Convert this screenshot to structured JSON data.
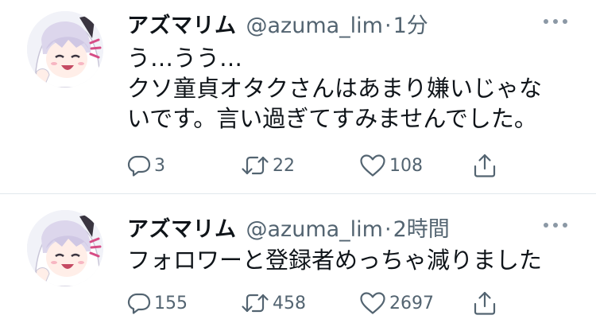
{
  "tweets": [
    {
      "author": {
        "display_name": "アズマリム",
        "handle": "@azuma_lim"
      },
      "separator": "·",
      "time": "1分",
      "text_lines": [
        "う…うう…",
        "クソ童貞オタクさんはあまり嫌いじゃな",
        "いです。言い過ぎてすみませんでした。"
      ],
      "counts": {
        "reply": "3",
        "retweet": "22",
        "like": "108"
      }
    },
    {
      "author": {
        "display_name": "アズマリム",
        "handle": "@azuma_lim"
      },
      "separator": "·",
      "time": "2時間",
      "text_lines": [
        "フォロワーと登録者めっちゃ減りました"
      ],
      "counts": {
        "reply": "155",
        "retweet": "458",
        "like": "2697"
      }
    }
  ],
  "icons": {
    "avatar": "anime-girl-avatar",
    "more": "more-dots-icon",
    "reply": "reply-icon",
    "retweet": "retweet-icon",
    "like": "heart-icon",
    "share": "share-icon"
  },
  "colors": {
    "text_primary": "#0f1419",
    "text_secondary": "#536471",
    "divider": "#e1e8ed",
    "avatar_accent": "#d64d86"
  }
}
